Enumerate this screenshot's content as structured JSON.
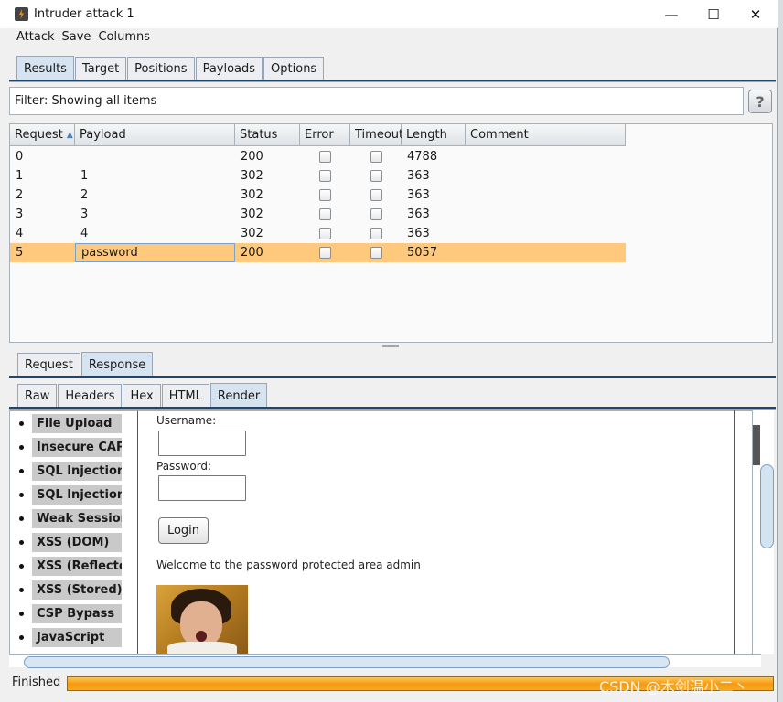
{
  "window": {
    "title": "Intruder attack 1",
    "minimize": "—",
    "maximize": "☐",
    "close": "✕"
  },
  "menu": [
    "Attack",
    "Save",
    "Columns"
  ],
  "main_tabs": [
    {
      "label": "Results",
      "active": true
    },
    {
      "label": "Target",
      "active": false
    },
    {
      "label": "Positions",
      "active": false
    },
    {
      "label": "Payloads",
      "active": false
    },
    {
      "label": "Options",
      "active": false
    }
  ],
  "filter": {
    "text": "Filter: Showing all items",
    "help": "?"
  },
  "results_table": {
    "columns": [
      "Request",
      "Payload",
      "Status",
      "Error",
      "Timeout",
      "Length",
      "Comment"
    ],
    "sort_indicator": "▲",
    "rows": [
      {
        "request": "0",
        "payload": "",
        "status": "200",
        "error": false,
        "timeout": false,
        "length": "4788",
        "comment": ""
      },
      {
        "request": "1",
        "payload": "1",
        "status": "302",
        "error": false,
        "timeout": false,
        "length": "363",
        "comment": ""
      },
      {
        "request": "2",
        "payload": "2",
        "status": "302",
        "error": false,
        "timeout": false,
        "length": "363",
        "comment": ""
      },
      {
        "request": "3",
        "payload": "3",
        "status": "302",
        "error": false,
        "timeout": false,
        "length": "363",
        "comment": ""
      },
      {
        "request": "4",
        "payload": "4",
        "status": "302",
        "error": false,
        "timeout": false,
        "length": "363",
        "comment": ""
      },
      {
        "request": "5",
        "payload": "password",
        "status": "200",
        "error": false,
        "timeout": false,
        "length": "5057",
        "comment": "",
        "selected": true
      }
    ]
  },
  "detail_tabs": [
    {
      "label": "Request",
      "active": false
    },
    {
      "label": "Response",
      "active": true
    }
  ],
  "view_tabs": [
    {
      "label": "Raw",
      "active": false
    },
    {
      "label": "Headers",
      "active": false
    },
    {
      "label": "Hex",
      "active": false
    },
    {
      "label": "HTML",
      "active": false
    },
    {
      "label": "Render",
      "active": true
    }
  ],
  "render": {
    "sidebar_items": [
      "File Upload",
      "Insecure CAPTCHA",
      "SQL Injection",
      "SQL Injection (Blind)",
      "Weak Session IDs",
      "XSS (DOM)",
      "XSS (Reflected)",
      "XSS (Stored)",
      "CSP Bypass",
      "JavaScript"
    ],
    "username_label": "Username:",
    "password_label": "Password:",
    "login_button": "Login",
    "welcome_text": "Welcome to the password protected area admin"
  },
  "status": {
    "text": "Finished",
    "progress": 1.0,
    "color": "#f59a0e"
  },
  "watermark": "CSDN @木剑温小二丶"
}
